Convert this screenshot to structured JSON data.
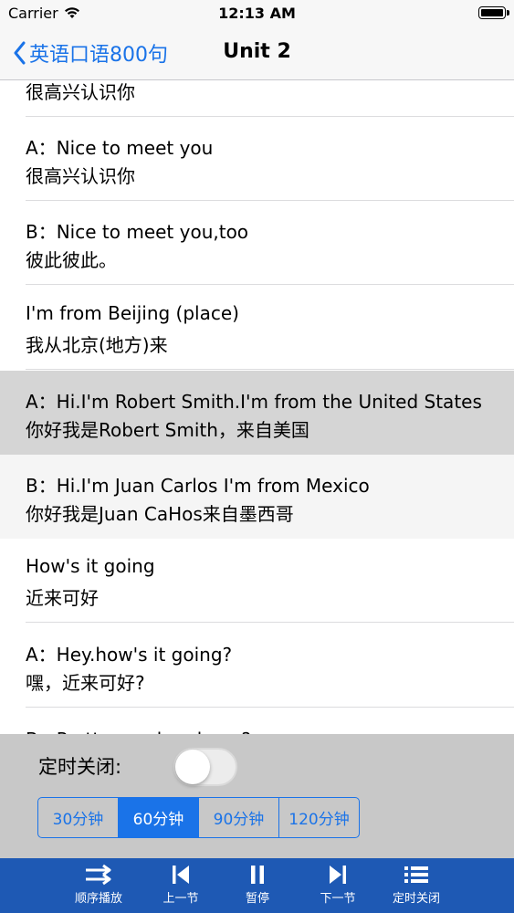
{
  "status_bar": {
    "carrier": "Carrier",
    "time": "12:13 AM"
  },
  "nav": {
    "back_label": "英语口语800句",
    "title": "Unit 2"
  },
  "list": {
    "partial_top_zh": "很高兴认识你",
    "items": [
      {
        "en": "A：Nice to meet you",
        "zh": "很高兴认识你"
      },
      {
        "en": "B：Nice to meet you,too",
        "zh": "彼此彼此。"
      },
      {
        "en": "I'm from Beijing (place)",
        "zh": "我从北京(地方)来"
      },
      {
        "en": "A：Hi.I'm Robert Smith.I'm from the United States",
        "zh": "你好我是Robert Smith，来自美国"
      },
      {
        "en": "B：Hi.I'm Juan Carlos I'm from Mexico",
        "zh": "你好我是Juan CaHos来自墨西哥"
      },
      {
        "en": "How's it going",
        "zh": "近来可好"
      },
      {
        "en": "A：Hey.how's it going?",
        "zh": "嘿，近来可好?"
      }
    ],
    "partial_bottom_en": "B：Pretty good and you?"
  },
  "timer": {
    "label": "定时关闭:",
    "enabled": false,
    "options": [
      "30分钟",
      "60分钟",
      "90分钟",
      "120分钟"
    ],
    "selected": "60分钟"
  },
  "toolbar": {
    "order_play": "顺序播放",
    "prev": "上一节",
    "pause": "暂停",
    "next": "下一节",
    "timer_off": "定时关闭"
  },
  "colors": {
    "accent": "#1a73e8",
    "toolbar_bg": "#1e59b4",
    "selected_row": "#d5d5d5"
  }
}
